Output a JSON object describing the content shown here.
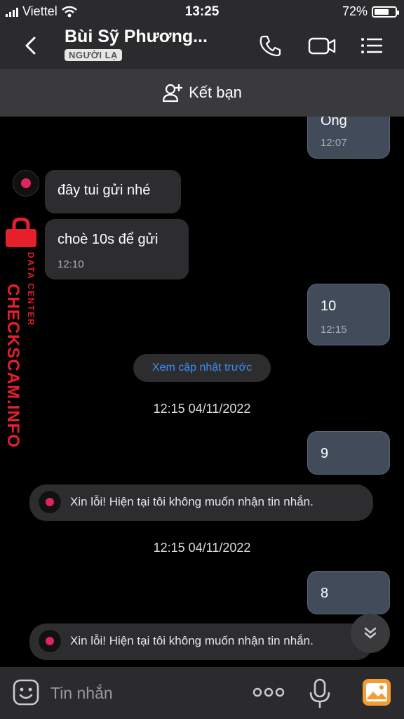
{
  "status_bar": {
    "carrier": "Viettel",
    "time": "13:25",
    "battery": "72%",
    "battery_level": 0.72
  },
  "header": {
    "title": "Bùi Sỹ Phương...",
    "badge": "NGƯỜI LẠ",
    "icons": [
      "back-icon",
      "phone-icon",
      "video-call-icon",
      "menu-icon"
    ]
  },
  "friend_bar": {
    "label": "Kết bạn",
    "icon": "add-user-icon"
  },
  "messages": {
    "m0": {
      "text": "Ông",
      "time": "12:07",
      "direction": "out"
    },
    "m1": {
      "text": "đây tui gửi nhé",
      "direction": "in"
    },
    "m2": {
      "text": "choè 10s để gửi",
      "time": "12:10",
      "direction": "in"
    },
    "m3": {
      "text": "10",
      "time": "12:15",
      "direction": "out"
    },
    "see_previous": "Xem cập nhật trước",
    "divider1": "12:15 04/11/2022",
    "m4": {
      "text": "9",
      "direction": "out"
    },
    "sys1": "Xin lỗi! Hiện tại tôi không muốn nhận tin nhắn.",
    "divider2": "12:15 04/11/2022",
    "m5": {
      "text": "8",
      "direction": "out"
    },
    "sys2": "Xin lỗi! Hiện tại tôi không muốn nhận tin nhắn."
  },
  "watermark": {
    "main": "CHECKSCAM.INFO",
    "sub": "DATA CENTER"
  },
  "input_bar": {
    "placeholder": "Tin nhắn",
    "icons": [
      "sticker-icon",
      "more-icon",
      "microphone-icon",
      "gallery-icon"
    ]
  },
  "colors": {
    "outgoing_bubble": "#414b5a",
    "incoming_bubble": "#2d2d30",
    "link": "#3a8ef0",
    "watermark": "#e5202b",
    "gallery_icon": "#f39c33"
  }
}
